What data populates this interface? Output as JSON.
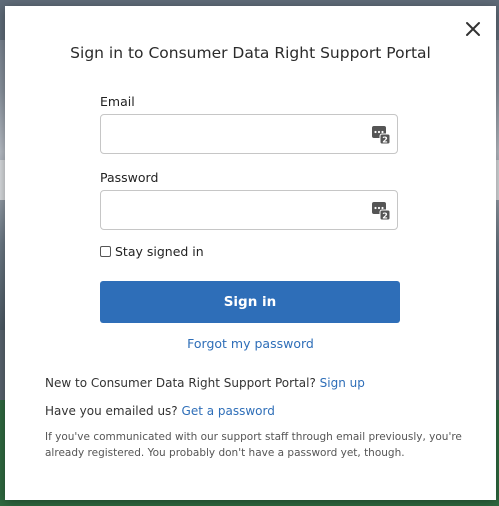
{
  "modal": {
    "title": "Sign in to Consumer Data Right Support Portal",
    "close_icon": "close-icon"
  },
  "form": {
    "email_label": "Email",
    "email_value": "",
    "password_label": "Password",
    "password_value": "",
    "password_manager_icon": "password-manager-icon",
    "stay_signed_in_label": "Stay signed in",
    "stay_signed_in_checked": false,
    "signin_label": "Sign in",
    "forgot_label": "Forgot my password"
  },
  "footer": {
    "new_text": "New to Consumer Data Right Support Portal?",
    "signup_label": "Sign up",
    "emailed_text": "Have you emailed us?",
    "get_password_label": "Get a password",
    "info_text": "If you've communicated with our support staff through email previously, you're already registered. You probably don't have a password yet, though."
  },
  "colors": {
    "accent": "#2e6eb8",
    "background_top": "#6b7684",
    "background_bottom": "#2d6a3e"
  }
}
